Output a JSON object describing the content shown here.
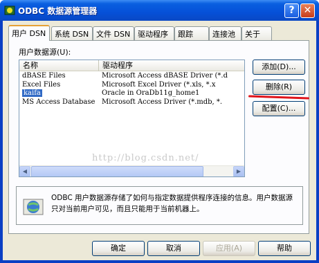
{
  "window": {
    "title": "ODBC 数据源管理器"
  },
  "title_buttons": {
    "help": "?",
    "close": "✕"
  },
  "tabs": [
    {
      "label": "用户 DSN"
    },
    {
      "label": "系统 DSN"
    },
    {
      "label": "文件 DSN"
    },
    {
      "label": "驱动程序"
    },
    {
      "label": "跟踪"
    },
    {
      "label": "连接池"
    },
    {
      "label": "关于"
    }
  ],
  "panel": {
    "list_label": "用户数据源(U):",
    "columns": [
      "名称",
      "驱动程序"
    ],
    "rows": [
      {
        "name": "dBASE Files",
        "driver": "Microsoft Access dBASE Driver (*.d"
      },
      {
        "name": "Excel Files",
        "driver": "Microsoft Excel Driver (*.xls, *.x"
      },
      {
        "name": "kaifa",
        "driver": "Oracle in OraDb11g_home1",
        "selected": true
      },
      {
        "name": "MS Access Database",
        "driver": "Microsoft Access Driver (*.mdb, *."
      }
    ],
    "buttons": {
      "add": "添加(D)...",
      "remove": "删除(R)",
      "configure": "配置(C)..."
    },
    "info": "ODBC 用户数据源存储了如何与指定数据提供程序连接的信息。用户数据源只对当前用户可见，而且只能用于当前机器上。"
  },
  "footer": {
    "ok": "确定",
    "cancel": "取消",
    "apply": "应用(A)",
    "help": "帮助"
  },
  "watermark": "http://blog.csdn.net/"
}
